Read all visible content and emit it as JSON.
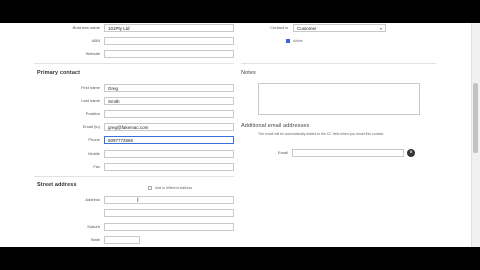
{
  "company": {
    "business_name_label": "Business name",
    "business_name_value": "101Pty Ltd",
    "abn_label": "ABN",
    "website_label": "Website",
    "contact_is_label": "Contact is",
    "contact_is_value": "Customer",
    "active_label": "Active"
  },
  "primary_contact": {
    "heading": "Primary contact",
    "first_name_label": "First name",
    "first_name_value": "Greg",
    "last_name_label": "Last name",
    "last_name_value": "Smith",
    "position_label": "Position",
    "email_label": "Email (to)",
    "email_value": "greg@fakemac.com",
    "phone_label": "Phone",
    "phone_value": "6097772666",
    "mobile_label": "Mobile",
    "fax_label": "Fax"
  },
  "notes": {
    "heading": "Notes"
  },
  "additional_emails": {
    "heading": "Additional email addresses",
    "description": "The email will be automatically added to the CC field when you email this contact",
    "email_label": "Email"
  },
  "street_address": {
    "heading": "Street address",
    "add_different_label": "Add to different address",
    "address_label": "Address",
    "suburb_label": "Suburb",
    "state_label": "State"
  }
}
